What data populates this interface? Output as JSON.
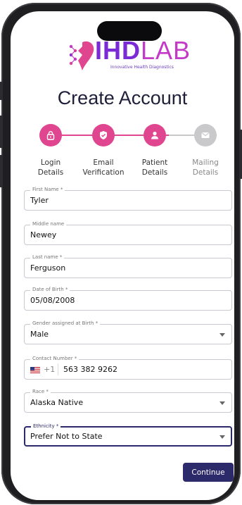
{
  "brand": {
    "name_bold": "IHD",
    "name_light": "LAB",
    "tagline": "Innovative Health Diagnostics"
  },
  "title": "Create Account",
  "steps": [
    {
      "label_line1": "Login",
      "label_line2": "Details",
      "state": "complete",
      "icon": "lock-icon"
    },
    {
      "label_line1": "Email",
      "label_line2": "Verification",
      "state": "complete",
      "icon": "shield-check-icon"
    },
    {
      "label_line1": "Patient",
      "label_line2": "Details",
      "state": "active",
      "icon": "person-icon"
    },
    {
      "label_line1": "Mailing",
      "label_line2": "Details",
      "state": "pending",
      "icon": "mail-icon"
    }
  ],
  "form": {
    "first_name": {
      "label": "First Name *",
      "value": "Tyler"
    },
    "middle_name": {
      "label": "Middle name",
      "value": "Newey"
    },
    "last_name": {
      "label": "Last name *",
      "value": "Ferguson"
    },
    "dob": {
      "label": "Date of Birth *",
      "value": "05/08/2008"
    },
    "gender": {
      "label": "Gender assigned at Birth *",
      "value": "Male"
    },
    "contact": {
      "label": "Contact Number *",
      "country_code": "+1",
      "value": "563 382 9262"
    },
    "race": {
      "label": "Race *",
      "value": "Alaska Native"
    },
    "ethnicity": {
      "label": "Ethnicity *",
      "value": "Prefer Not to State"
    }
  },
  "continue_label": "Continue",
  "colors": {
    "accent_pink": "#e0468f",
    "step_pending": "#c9c9cc",
    "primary_navy": "#2d2a6b",
    "brand_purple": "#7b2bd6"
  }
}
